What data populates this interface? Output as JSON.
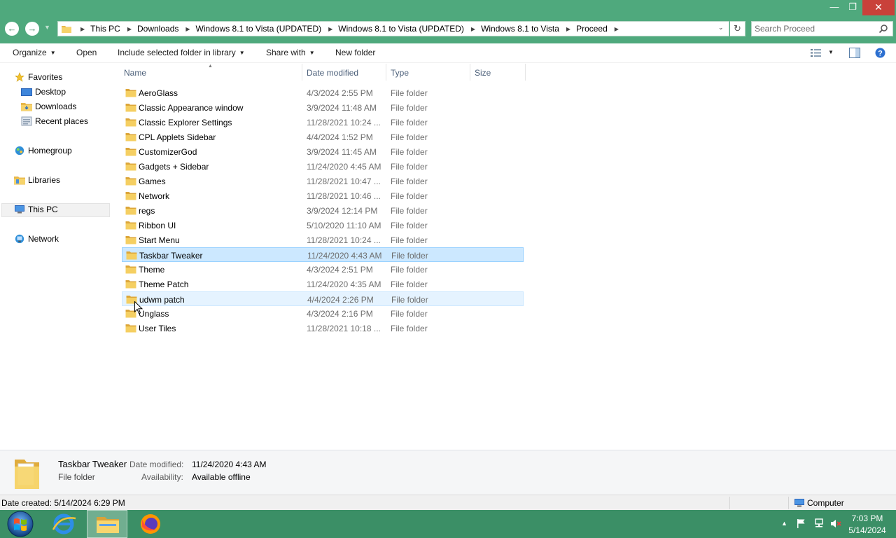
{
  "window": {
    "minimize_glyph": "—",
    "maximize_glyph": "❐",
    "close_glyph": "✕",
    "accent": "#4fa97d",
    "close_color": "#c9413a"
  },
  "nav_buttons": {
    "back_glyph": "←",
    "forward_glyph": "→",
    "recent_glyph": "▼"
  },
  "address": {
    "crumbs": [
      "This PC",
      "Downloads",
      "Windows 8.1 to Vista (UPDATED)",
      "Windows 8.1 to Vista (UPDATED)",
      "Windows 8.1 to Vista",
      "Proceed"
    ],
    "refresh_glyph": "↻",
    "dropdown_glyph": "⌄"
  },
  "search": {
    "placeholder": "Search Proceed"
  },
  "toolbar": {
    "organize": "Organize",
    "open": "Open",
    "include_library": "Include selected folder in library",
    "share_with": "Share with",
    "new_folder": "New folder"
  },
  "nav_pane": {
    "favorites": "Favorites",
    "desktop": "Desktop",
    "downloads": "Downloads",
    "recent_places": "Recent places",
    "homegroup": "Homegroup",
    "libraries": "Libraries",
    "this_pc": "This PC",
    "network": "Network"
  },
  "columns": {
    "name": "Name",
    "date_modified": "Date modified",
    "type": "Type",
    "size": "Size"
  },
  "files": [
    {
      "name": "AeroGlass",
      "date": "4/3/2024 2:55 PM",
      "type": "File folder",
      "size": "",
      "state": "normal"
    },
    {
      "name": "Classic Appearance window",
      "date": "3/9/2024 11:48 AM",
      "type": "File folder",
      "size": "",
      "state": "normal"
    },
    {
      "name": "Classic Explorer Settings",
      "date": "11/28/2021 10:24 ...",
      "type": "File folder",
      "size": "",
      "state": "normal"
    },
    {
      "name": "CPL Applets Sidebar",
      "date": "4/4/2024 1:52 PM",
      "type": "File folder",
      "size": "",
      "state": "normal"
    },
    {
      "name": "CustomizerGod",
      "date": "3/9/2024 11:45 AM",
      "type": "File folder",
      "size": "",
      "state": "normal"
    },
    {
      "name": "Gadgets + Sidebar",
      "date": "11/24/2020 4:45 AM",
      "type": "File folder",
      "size": "",
      "state": "normal"
    },
    {
      "name": "Games",
      "date": "11/28/2021 10:47 ...",
      "type": "File folder",
      "size": "",
      "state": "normal"
    },
    {
      "name": "Network",
      "date": "11/28/2021 10:46 ...",
      "type": "File folder",
      "size": "",
      "state": "normal"
    },
    {
      "name": "regs",
      "date": "3/9/2024 12:14 PM",
      "type": "File folder",
      "size": "",
      "state": "normal"
    },
    {
      "name": "Ribbon UI",
      "date": "5/10/2020 11:10 AM",
      "type": "File folder",
      "size": "",
      "state": "normal"
    },
    {
      "name": "Start Menu",
      "date": "11/28/2021 10:24 ...",
      "type": "File folder",
      "size": "",
      "state": "normal"
    },
    {
      "name": "Taskbar Tweaker",
      "date": "11/24/2020 4:43 AM",
      "type": "File folder",
      "size": "",
      "state": "selected"
    },
    {
      "name": "Theme",
      "date": "4/3/2024 2:51 PM",
      "type": "File folder",
      "size": "",
      "state": "normal"
    },
    {
      "name": "Theme Patch",
      "date": "11/24/2020 4:35 AM",
      "type": "File folder",
      "size": "",
      "state": "normal"
    },
    {
      "name": "udwm patch",
      "date": "4/4/2024 2:26 PM",
      "type": "File folder",
      "size": "",
      "state": "hover"
    },
    {
      "name": "Unglass",
      "date": "4/3/2024 2:16 PM",
      "type": "File folder",
      "size": "",
      "state": "normal"
    },
    {
      "name": "User Tiles",
      "date": "11/28/2021 10:18 ...",
      "type": "File folder",
      "size": "",
      "state": "normal"
    }
  ],
  "details": {
    "name": "Taskbar Tweaker",
    "kind": "File folder",
    "date_label": "Date modified:",
    "date_value": "11/24/2020 4:43 AM",
    "avail_label": "Availability:",
    "avail_value": "Available offline"
  },
  "status": {
    "left": "Date created: 5/14/2024 6:29 PM",
    "right": "Computer"
  },
  "taskbar": {
    "time": "7:03 PM",
    "date": "5/14/2024",
    "tray_up_glyph": "▲"
  }
}
